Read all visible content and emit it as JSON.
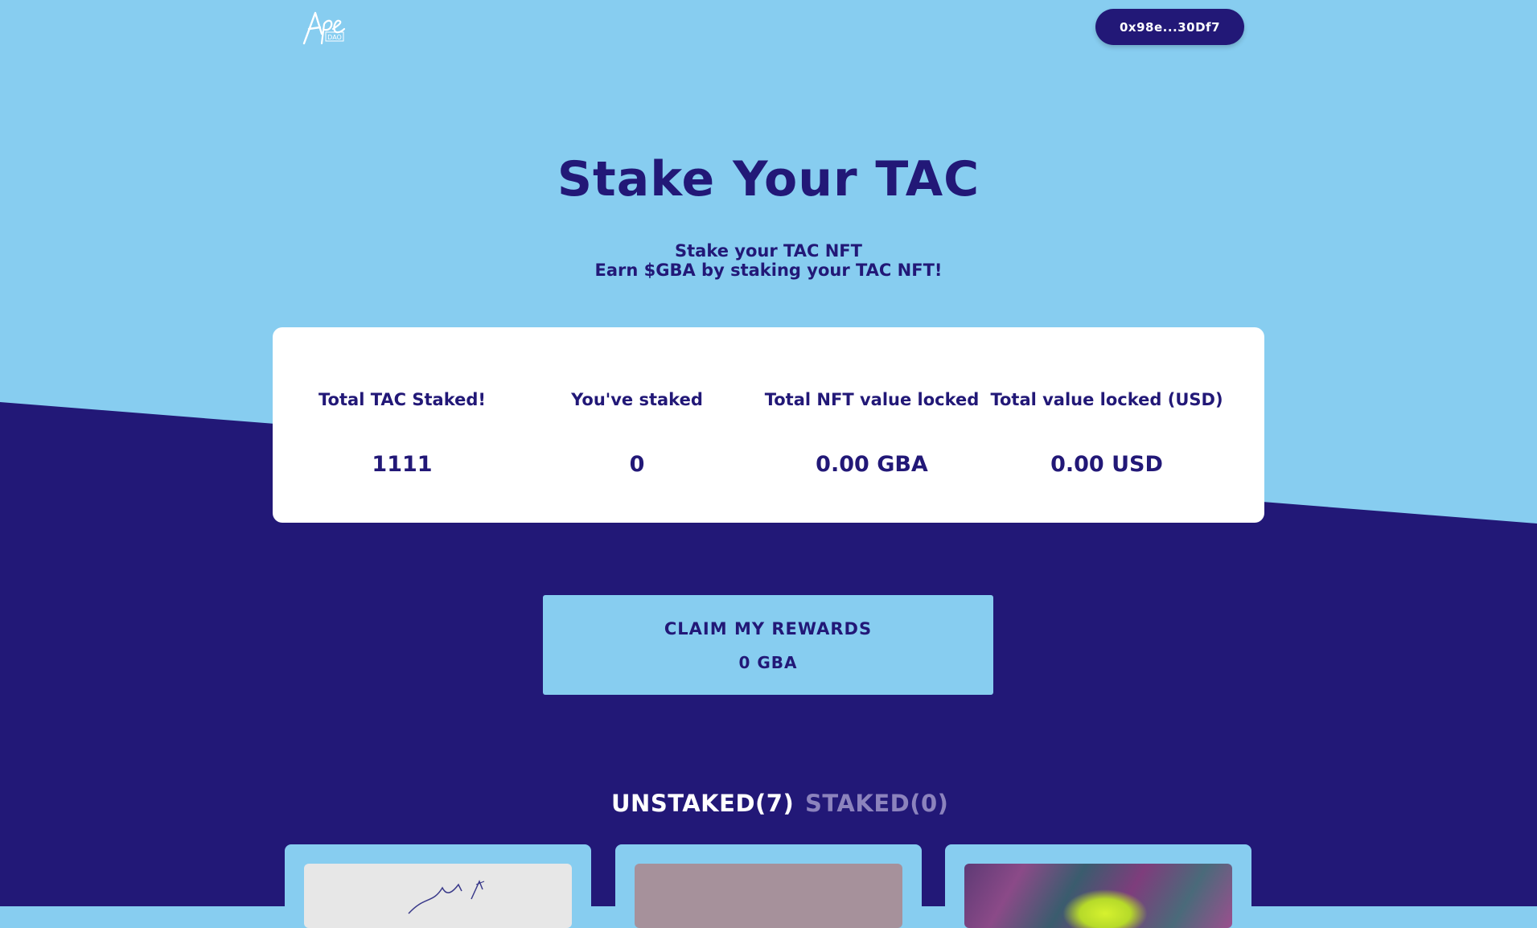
{
  "header": {
    "logo_text": "Ape DAO",
    "wallet_address": "0x98e...30Df7"
  },
  "hero": {
    "title": "Stake Your TAC",
    "subtitle_line1": "Stake your TAC NFT",
    "subtitle_line2": "Earn $GBA by staking your TAC NFT!"
  },
  "stats": [
    {
      "label": "Total TAC Staked!",
      "value": "1111"
    },
    {
      "label": "You've staked",
      "value": "0"
    },
    {
      "label": "Total NFT value locked",
      "value": "0.00 GBA"
    },
    {
      "label": "Total value locked (USD)",
      "value": "0.00 USD"
    }
  ],
  "claim": {
    "label": "CLAIM MY REWARDS",
    "amount": "0 GBA"
  },
  "tabs": {
    "unstaked": "UNSTAKED(7)",
    "staked": "STAKED(0)"
  },
  "colors": {
    "sky": "#87cdf0",
    "navy": "#221877",
    "white": "#ffffff",
    "tab_inactive": "#8c83bd"
  }
}
